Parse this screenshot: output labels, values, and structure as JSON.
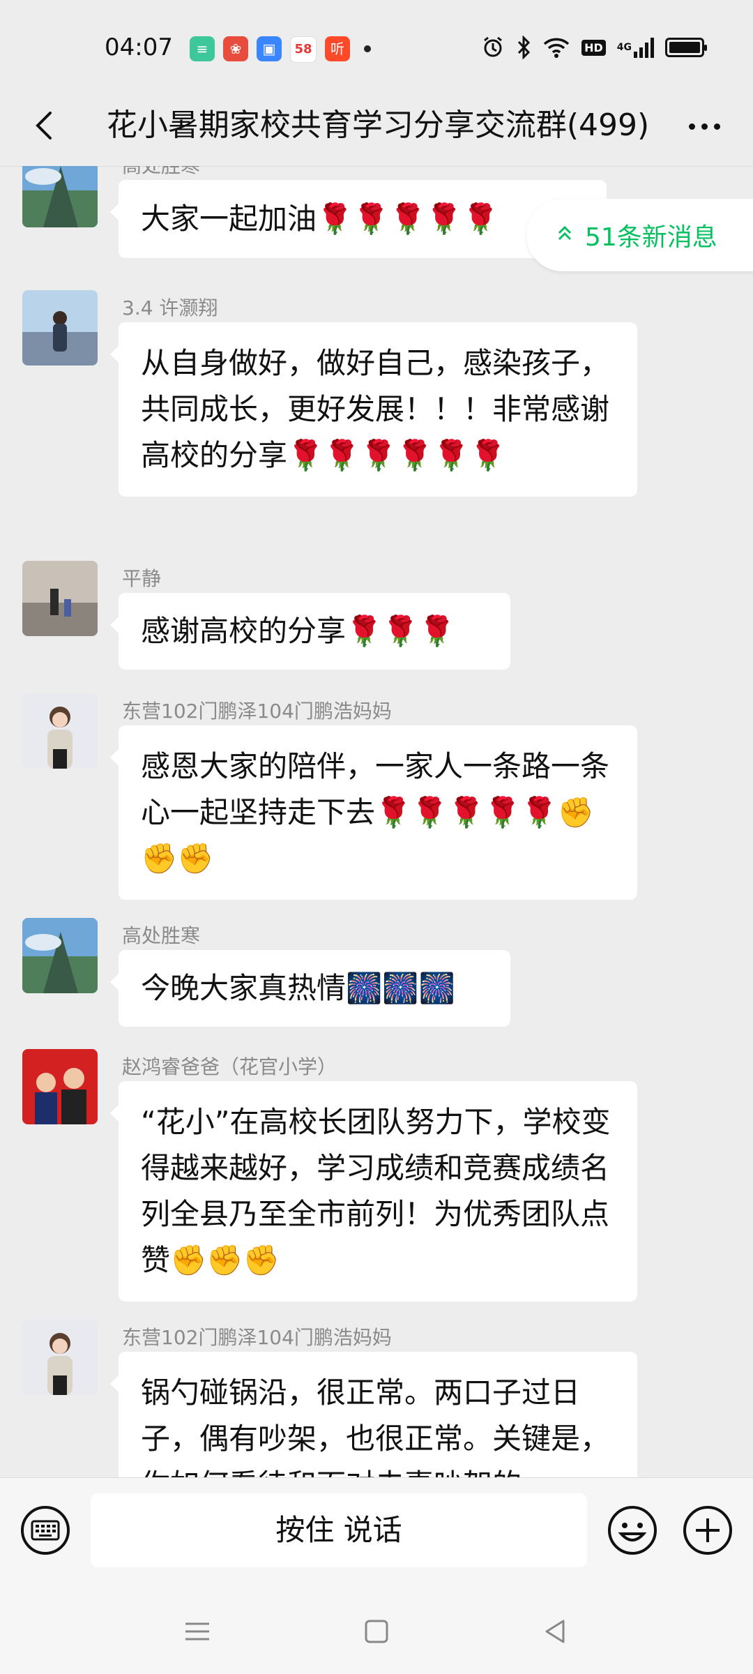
{
  "status_bar": {
    "time": "04:07",
    "app_badges": [
      {
        "name": "app-badge-green",
        "glyph": "≡",
        "color": "#3ec79a"
      },
      {
        "name": "app-badge-red",
        "glyph": "❀",
        "color": "#e74c3c"
      },
      {
        "name": "app-badge-blue",
        "glyph": "▣",
        "color": "#3a86ff"
      },
      {
        "name": "app-badge-58",
        "glyph": "58",
        "color": "#ffffff"
      },
      {
        "name": "app-badge-listen",
        "glyph": "听",
        "color": "#ff4a2a"
      }
    ],
    "network": "4G",
    "hd": "HD"
  },
  "header": {
    "title": "花小暑期家校共育学习分享交流群(499)"
  },
  "new_messages": {
    "label": "51条新消息"
  },
  "messages": [
    {
      "sender": "高处胜寒",
      "text": "大家一起加油🌹🌹🌹🌹🌹"
    },
    {
      "sender": "3.4 许灏翔",
      "text": "从自身做好，做好自己，感染孩子，共同成长，更好发展！！！非常感谢高校的分享🌹🌹🌹🌹🌹🌹"
    },
    {
      "sender": "平静",
      "text": "感谢高校的分享🌹🌹🌹"
    },
    {
      "sender": "东营102门鹏泽104门鹏浩妈妈",
      "text": "感恩大家的陪伴，一家人一条路一条心一起坚持走下去🌹🌹🌹🌹🌹✊✊✊"
    },
    {
      "sender": "高处胜寒",
      "text": "今晚大家真热情🎆🎆🎆"
    },
    {
      "sender": "赵鸿睿爸爸（花官小学）",
      "text": "“花小”在高校长团队努力下，学校变得越来越好，学习成绩和竞赛成绩名列全县乃至全市前列！为优秀团队点赞✊✊✊"
    },
    {
      "sender": "东营102门鹏泽104门鹏浩妈妈",
      "text": "锅勺碰锅沿，很正常。两口子过日子，偶有吵架，也很正常。关键是，你如何看待和面对夫妻吵架的"
    }
  ],
  "input_bar": {
    "hold_to_talk": "按住 说话"
  }
}
